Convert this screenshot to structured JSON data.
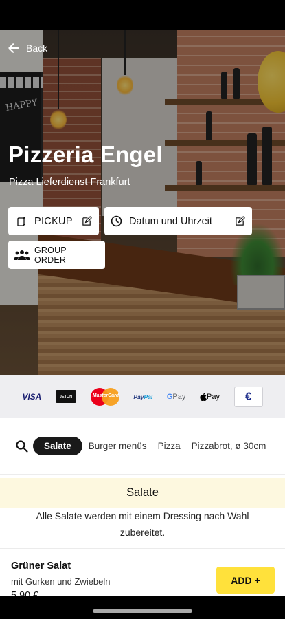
{
  "header": {
    "back_label": "Back",
    "restaurant_name": "Pizzeria Engel",
    "tagline": "Pizza Lieferdienst Frankfurt",
    "board_text": "HAPPY"
  },
  "order_options": {
    "pickup_label": "PICKUP",
    "datetime_label": "Datum und Uhrzeit",
    "group_order_label": "GROUP ORDER"
  },
  "payments": {
    "methods": [
      "VISA",
      "JETON",
      "MasterCard",
      "PayPal",
      "G Pay",
      "Pay",
      "€"
    ],
    "visa": "VISA",
    "jeton": "JETON",
    "mastercard": "MasterCard",
    "paypal_1": "Pay",
    "paypal_2": "Pal",
    "gpay_g": "G",
    "gpay_text": " Pay",
    "applepay_text": "Pay",
    "euro": "€"
  },
  "categories": {
    "items": [
      "Salate",
      "Burger menüs",
      "Pizza",
      "Pizzabrot, ø 30cm"
    ],
    "active": "Salate"
  },
  "section": {
    "title": "Salate",
    "description": "Alle Salate werden mit einem Dressing nach Wahl zubereitet."
  },
  "menu_item": {
    "name": "Grüner Salat",
    "description": "mit Gurken und Zwiebeln",
    "price": "5,90 €",
    "add_label": "ADD +"
  },
  "colors": {
    "accent_yellow": "#ffe13b",
    "section_bg": "#fdf8df",
    "active_tab": "#1a1a1a"
  }
}
